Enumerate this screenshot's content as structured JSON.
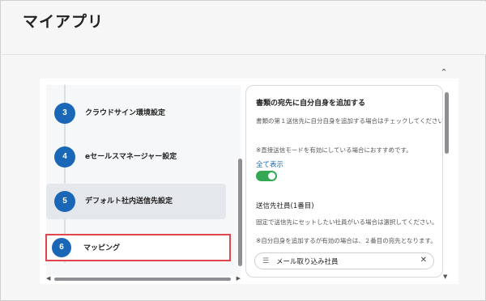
{
  "app": {
    "title": "マイアプリ"
  },
  "steps": [
    {
      "number": "3",
      "label": "クラウドサイン環境設定",
      "active": false
    },
    {
      "number": "4",
      "label": "eセールスマネージャー設定",
      "active": false
    },
    {
      "number": "5",
      "label": "デフォルト社内送信先設定",
      "active": true
    },
    {
      "number": "6",
      "label": "マッピング",
      "active": false,
      "highlighted": true
    }
  ],
  "settings": {
    "self_recipient": {
      "title": "書類の宛先に自分自身を追加する",
      "description": "書類の第１送信先に自分自身を追加する場合はチェックしてください。",
      "note": "※直接送信モードを有効にしている場合におすすめです。",
      "show_all": "全て表示",
      "toggle_on": true
    },
    "recipient_employee": {
      "title": "送信先社員(1番目)",
      "description": "固定で送信先にセットしたい社員がいる場合は選択してください。",
      "note": "※自分自身を追加するが有効の場合は、２番目の宛先となります。",
      "selected_value": "メール取り込み社員"
    }
  },
  "icons": {
    "collapse": "chevron-up-icon",
    "select_list": "list-icon",
    "select_clear": "close-icon"
  },
  "colors": {
    "step_circle": "#1a67b8",
    "highlight_border": "#e0474c",
    "toggle_on": "#34a853",
    "link": "#1a67b8"
  }
}
